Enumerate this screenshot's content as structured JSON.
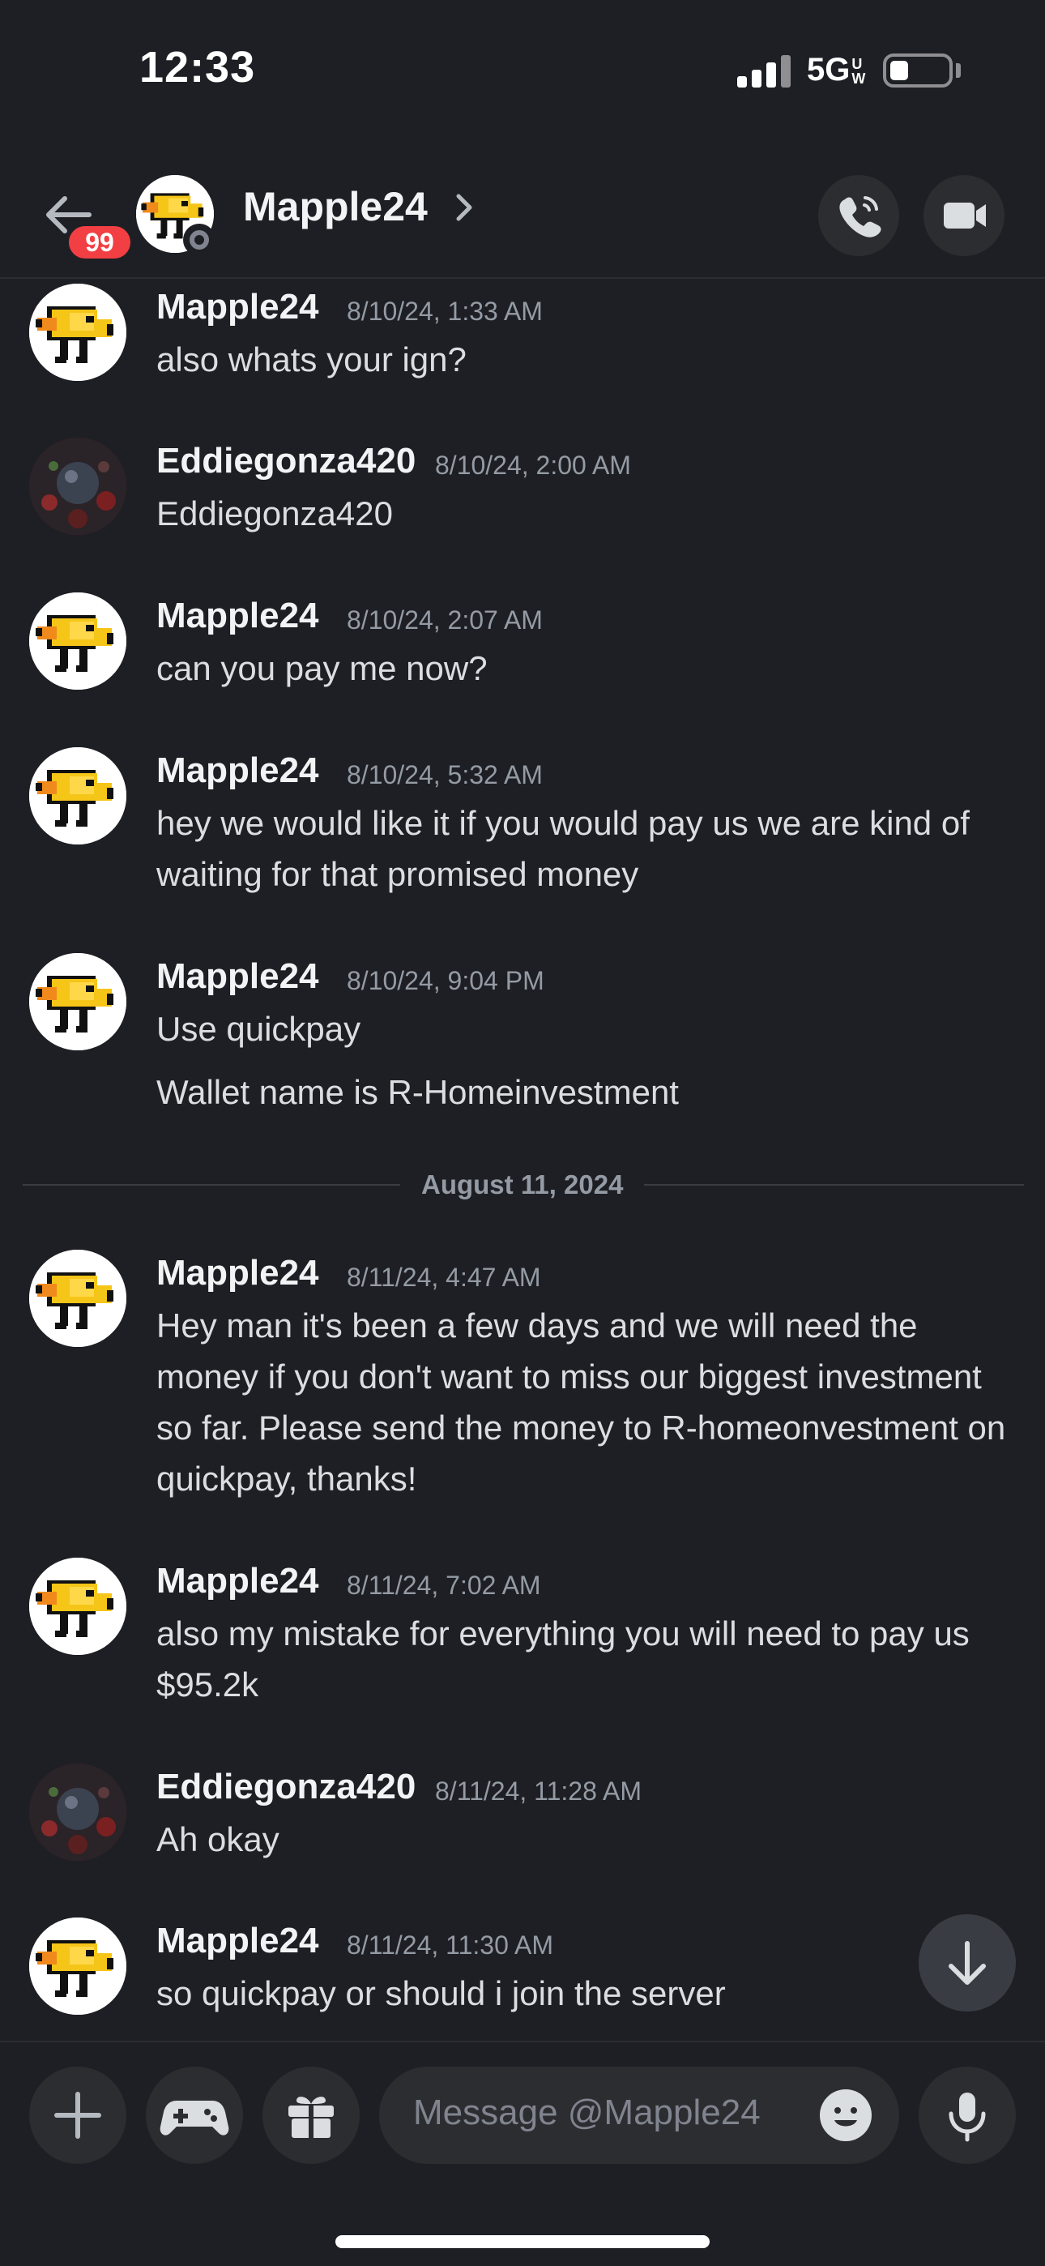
{
  "status_bar": {
    "time": "12:33",
    "network": "5G",
    "network_sup": "UW"
  },
  "header": {
    "unread_badge": "99",
    "name": "Mapple24"
  },
  "messages": [
    {
      "author": "Mapple24",
      "timestamp": "8/10/24, 1:33 AM",
      "lines": [
        "also whats your ign?"
      ]
    },
    {
      "author": "Eddiegonza420",
      "timestamp": "8/10/24, 2:00 AM",
      "lines": [
        "Eddiegonza420"
      ]
    },
    {
      "author": "Mapple24",
      "timestamp": "8/10/24, 2:07 AM",
      "lines": [
        "can you pay me now?"
      ]
    },
    {
      "author": "Mapple24",
      "timestamp": "8/10/24, 5:32 AM",
      "lines": [
        "hey we would like it if you would pay us we are kind of waiting for that promised money"
      ]
    },
    {
      "author": "Mapple24",
      "timestamp": "8/10/24, 9:04 PM",
      "lines": [
        "Use quickpay",
        "Wallet name is R-Homeinvestment"
      ]
    },
    {
      "author": "Mapple24",
      "timestamp": "8/11/24, 4:47 AM",
      "lines": [
        "Hey man it's been a few days and we will need the money if you don't want to miss our biggest investment so far. Please send the money to R-homeonvestment on quickpay, thanks!"
      ]
    },
    {
      "author": "Mapple24",
      "timestamp": "8/11/24, 7:02 AM",
      "lines": [
        "also my mistake for everything you will need to pay us $95.2k"
      ]
    },
    {
      "author": "Eddiegonza420",
      "timestamp": "8/11/24, 11:28 AM",
      "lines": [
        "Ah okay"
      ]
    },
    {
      "author": "Mapple24",
      "timestamp": "8/11/24, 11:30 AM",
      "lines": [
        "so quickpay or should i join the server"
      ]
    }
  ],
  "date_divider": "August 11, 2024",
  "composer": {
    "placeholder": "Message @Mapple24"
  },
  "icons": [
    "back-arrow-icon",
    "phone-call-icon",
    "video-camera-icon",
    "jump-down-icon",
    "plus-icon",
    "gamepad-icon",
    "gift-icon",
    "emoji-icon",
    "microphone-icon"
  ]
}
